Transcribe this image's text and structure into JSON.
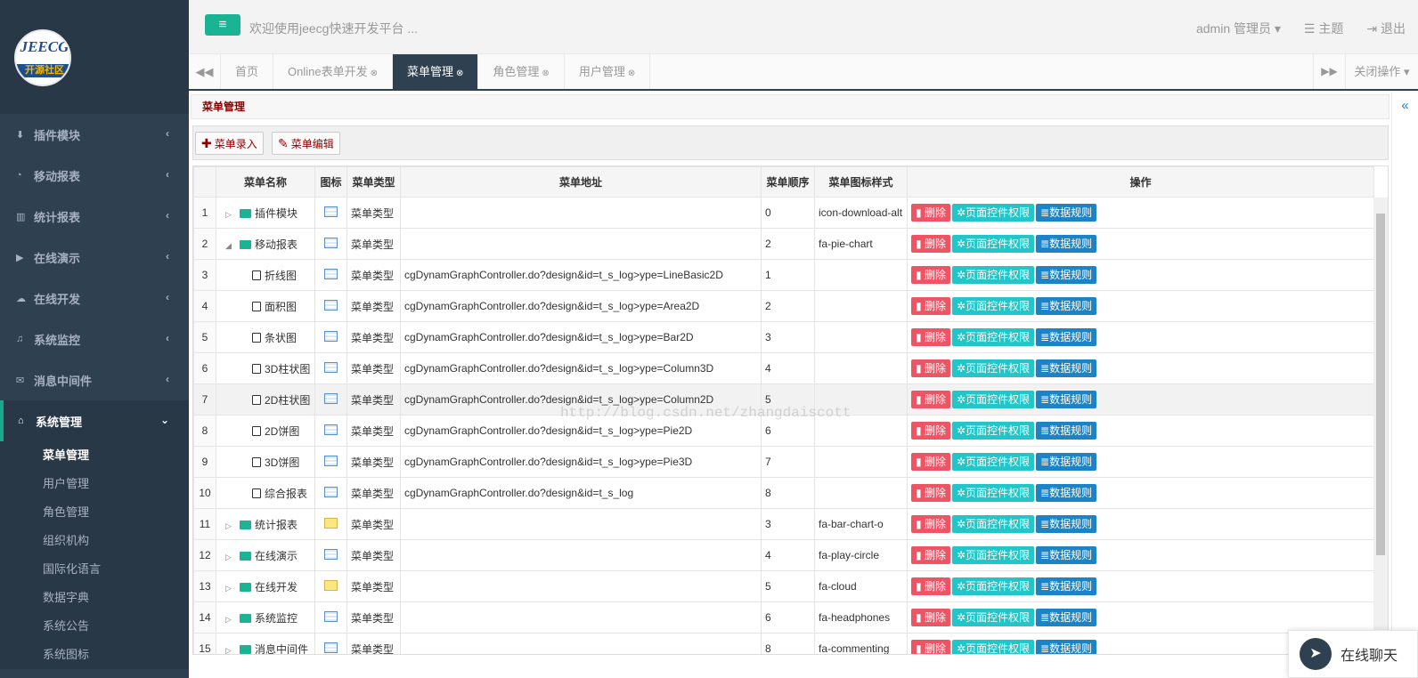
{
  "logo": {
    "line1": "JEECG",
    "line2": "开源社区"
  },
  "sidebar": {
    "items": [
      {
        "label": "插件模块",
        "icon": "download-icon",
        "glyph": "⬇"
      },
      {
        "label": "移动报表",
        "icon": "pie-chart-icon",
        "glyph": "◔"
      },
      {
        "label": "统计报表",
        "icon": "bar-chart-icon",
        "glyph": "▥"
      },
      {
        "label": "在线演示",
        "icon": "play-icon",
        "glyph": "▶"
      },
      {
        "label": "在线开发",
        "icon": "cloud-icon",
        "glyph": "☁"
      },
      {
        "label": "系统监控",
        "icon": "headphones-icon",
        "glyph": "♫"
      },
      {
        "label": "消息中间件",
        "icon": "comment-icon",
        "glyph": "✉"
      }
    ],
    "active": {
      "label": "系统管理",
      "icon": "home-icon",
      "glyph": "⌂"
    },
    "sub": [
      "菜单管理",
      "用户管理",
      "角色管理",
      "组织机构",
      "国际化语言",
      "数据字典",
      "系统公告",
      "系统图标"
    ]
  },
  "topbar": {
    "toggle": "≡",
    "welcome": "欢迎使用jeecg快速开发平台 ...",
    "user": "admin 管理员",
    "theme": "主题",
    "logout": "退出"
  },
  "tabs": {
    "items": [
      "首页",
      "Online表单开发",
      "菜单管理",
      "角色管理",
      "用户管理"
    ],
    "close_ops": "关闭操作"
  },
  "panel": {
    "title": "菜单管理",
    "add": "菜单录入",
    "edit": "菜单编辑"
  },
  "table": {
    "headers": [
      "菜单名称",
      "图标",
      "菜单类型",
      "菜单地址",
      "菜单顺序",
      "菜单图标样式",
      "操作"
    ],
    "actions": {
      "del": "删除",
      "perm": "页面控件权限",
      "data": "数据规则"
    },
    "rows": [
      {
        "n": "1",
        "name": "插件模块",
        "kind": "folder",
        "tree": "▷",
        "ind": 0,
        "ico": "grid",
        "type": "菜单类型",
        "url": "",
        "order": "0",
        "style": "icon-download-alt"
      },
      {
        "n": "2",
        "name": "移动报表",
        "kind": "folder-open",
        "tree": "◢",
        "ind": 0,
        "ico": "grid",
        "type": "菜单类型",
        "url": "",
        "order": "2",
        "style": "fa-pie-chart"
      },
      {
        "n": "3",
        "name": "折线图",
        "kind": "doc",
        "tree": "",
        "ind": 1,
        "ico": "grid",
        "type": "菜单类型",
        "url": "cgDynamGraphController.do?design&id=t_s_log>ype=LineBasic2D",
        "order": "1",
        "style": ""
      },
      {
        "n": "4",
        "name": "面积图",
        "kind": "doc",
        "tree": "",
        "ind": 1,
        "ico": "grid",
        "type": "菜单类型",
        "url": "cgDynamGraphController.do?design&id=t_s_log>ype=Area2D",
        "order": "2",
        "style": ""
      },
      {
        "n": "5",
        "name": "条状图",
        "kind": "doc",
        "tree": "",
        "ind": 1,
        "ico": "grid",
        "type": "菜单类型",
        "url": "cgDynamGraphController.do?design&id=t_s_log>ype=Bar2D",
        "order": "3",
        "style": ""
      },
      {
        "n": "6",
        "name": "3D柱状图",
        "kind": "doc",
        "tree": "",
        "ind": 1,
        "ico": "grid",
        "type": "菜单类型",
        "url": "cgDynamGraphController.do?design&id=t_s_log>ype=Column3D",
        "order": "4",
        "style": ""
      },
      {
        "n": "7",
        "name": "2D柱状图",
        "kind": "doc",
        "tree": "",
        "ind": 1,
        "ico": "grid",
        "type": "菜单类型",
        "url": "cgDynamGraphController.do?design&id=t_s_log>ype=Column2D",
        "order": "5",
        "style": ""
      },
      {
        "n": "8",
        "name": "2D饼图",
        "kind": "doc",
        "tree": "",
        "ind": 1,
        "ico": "grid",
        "type": "菜单类型",
        "url": "cgDynamGraphController.do?design&id=t_s_log>ype=Pie2D",
        "order": "6",
        "style": ""
      },
      {
        "n": "9",
        "name": "3D饼图",
        "kind": "doc",
        "tree": "",
        "ind": 1,
        "ico": "grid",
        "type": "菜单类型",
        "url": "cgDynamGraphController.do?design&id=t_s_log>ype=Pie3D",
        "order": "7",
        "style": ""
      },
      {
        "n": "10",
        "name": "综合报表",
        "kind": "doc",
        "tree": "",
        "ind": 1,
        "ico": "grid",
        "type": "菜单类型",
        "url": "cgDynamGraphController.do?design&id=t_s_log",
        "order": "8",
        "style": ""
      },
      {
        "n": "11",
        "name": "统计报表",
        "kind": "folder",
        "tree": "▷",
        "ind": 0,
        "ico": "folder",
        "type": "菜单类型",
        "url": "",
        "order": "3",
        "style": "fa-bar-chart-o"
      },
      {
        "n": "12",
        "name": "在线演示",
        "kind": "folder",
        "tree": "▷",
        "ind": 0,
        "ico": "grid",
        "type": "菜单类型",
        "url": "",
        "order": "4",
        "style": "fa-play-circle"
      },
      {
        "n": "13",
        "name": "在线开发",
        "kind": "folder",
        "tree": "▷",
        "ind": 0,
        "ico": "folder",
        "type": "菜单类型",
        "url": "",
        "order": "5",
        "style": "fa-cloud"
      },
      {
        "n": "14",
        "name": "系统监控",
        "kind": "folder",
        "tree": "▷",
        "ind": 0,
        "ico": "grid",
        "type": "菜单类型",
        "url": "",
        "order": "6",
        "style": "fa-headphones"
      },
      {
        "n": "15",
        "name": "消息中间件",
        "kind": "folder",
        "tree": "▷",
        "ind": 0,
        "ico": "grid",
        "type": "菜单类型",
        "url": "",
        "order": "8",
        "style": "fa-commenting"
      }
    ]
  },
  "watermark": "http://blog.csdn.net/zhangdaiscott",
  "chat": {
    "label": "在线聊天"
  }
}
